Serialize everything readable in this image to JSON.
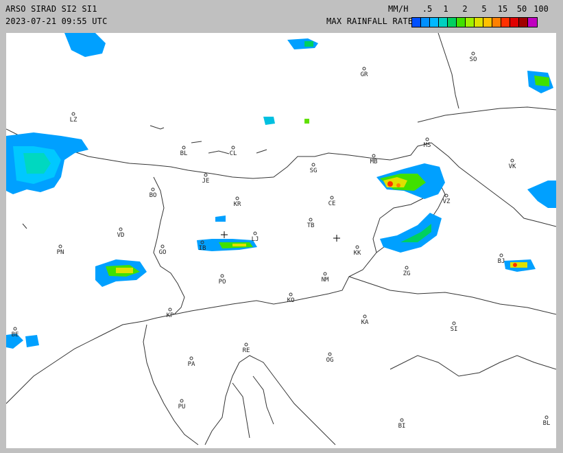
{
  "header": {
    "title": "ARSO SIRAD SI2 SI1",
    "datetime": "2023-07-21 09:55 UTC",
    "units": "MM/H",
    "scale_label": "MAX RAINFALL RATE"
  },
  "legend": {
    "ticks": [
      ".5",
      "1",
      "2",
      "5",
      "15",
      "50",
      "100"
    ],
    "colors": [
      "#0050ff",
      "#0090ff",
      "#00b8ff",
      "#00d0c0",
      "#00d060",
      "#40e000",
      "#a0f000",
      "#e0e000",
      "#ffc000",
      "#ff8000",
      "#ff3000",
      "#e00000",
      "#a00000",
      "#c000c0"
    ]
  },
  "cities": [
    {
      "code": "GR"
    },
    {
      "code": "SO"
    },
    {
      "code": "LZ"
    },
    {
      "code": "BL"
    },
    {
      "code": "CL"
    },
    {
      "code": "MB"
    },
    {
      "code": "MS"
    },
    {
      "code": "VK"
    },
    {
      "code": "JE"
    },
    {
      "code": "SG"
    },
    {
      "code": "BO"
    },
    {
      "code": "KR"
    },
    {
      "code": "CE"
    },
    {
      "code": "VZ"
    },
    {
      "code": "VD"
    },
    {
      "code": "LJ"
    },
    {
      "code": "TB"
    },
    {
      "code": "PN"
    },
    {
      "code": "GO"
    },
    {
      "code": "IB"
    },
    {
      "code": "KK"
    },
    {
      "code": "BJ"
    },
    {
      "code": "PO"
    },
    {
      "code": "NM"
    },
    {
      "code": "ZG"
    },
    {
      "code": "KO"
    },
    {
      "code": "KP"
    },
    {
      "code": "KA"
    },
    {
      "code": "SI"
    },
    {
      "code": "RE"
    },
    {
      "code": "PA"
    },
    {
      "code": "OG"
    },
    {
      "code": "PU"
    },
    {
      "code": "BI"
    },
    {
      "code": "BL"
    },
    {
      "code": "BE"
    }
  ]
}
